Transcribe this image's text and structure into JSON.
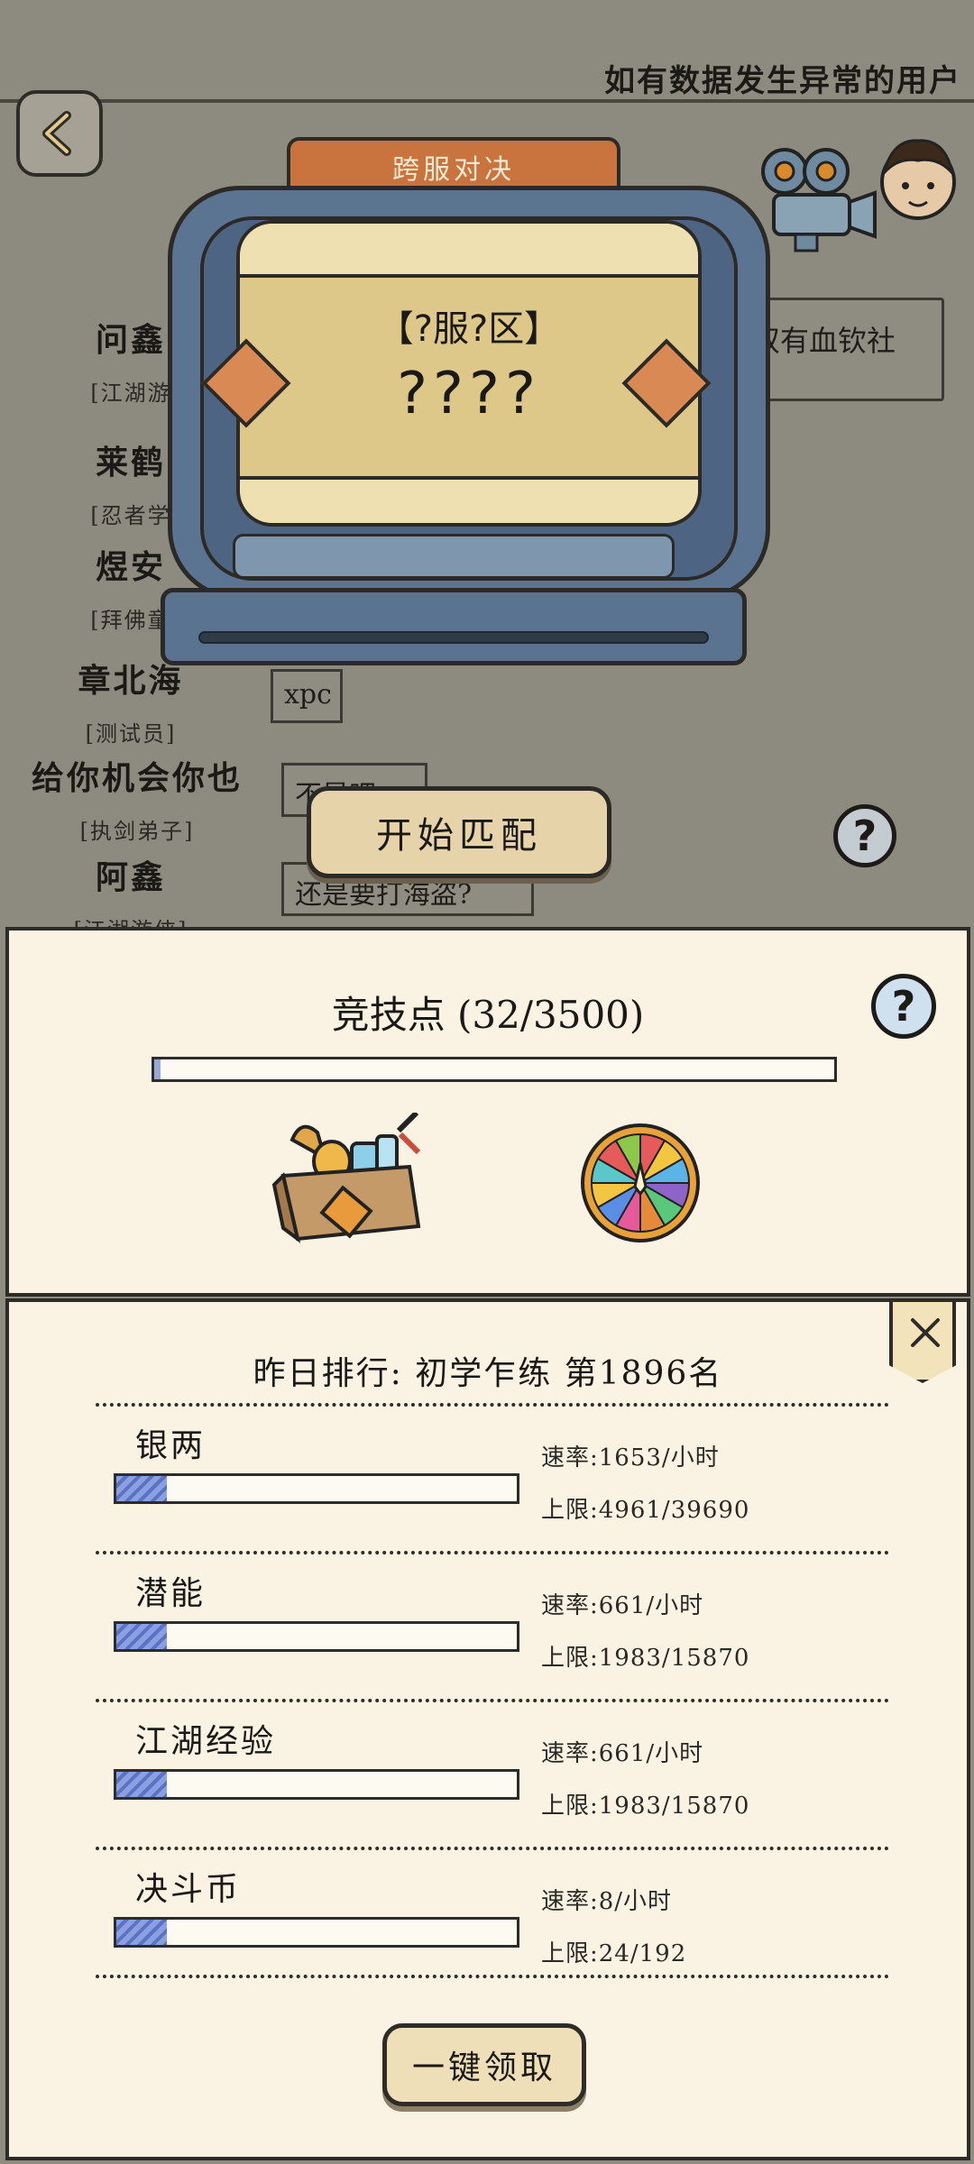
{
  "header": {
    "notice": "如有数据发生异常的用户"
  },
  "chat": {
    "snippet": "双有血钦社"
  },
  "players": [
    {
      "name": "问鑫",
      "title": "[江湖游"
    },
    {
      "name": "莱鹤",
      "title": "[忍者学"
    },
    {
      "name": "煜安",
      "title": "[拜佛童"
    },
    {
      "name": "章北海",
      "title": "[测试员]",
      "message": "xpc"
    },
    {
      "name": "给你机会你也",
      "title": "[执剑弟子]",
      "message": "不是吧"
    },
    {
      "name": "阿鑫",
      "title": "[江湖游侠]",
      "message": "还是要打海盗?"
    }
  ],
  "machine": {
    "tab": "跨服对决",
    "server": "【?服?区】",
    "opponent": "????"
  },
  "match": {
    "button": "开始匹配",
    "help": "?"
  },
  "arena": {
    "title": "竞技点 (32/3500)",
    "current": 32,
    "max": 3500,
    "help": "?"
  },
  "ranking": {
    "title": "昨日排行: 初学乍练  第1896名",
    "resources": [
      {
        "name": "银两",
        "rate": "速率:1653/小时",
        "cap": "上限:4961/39690",
        "fill": 0.125
      },
      {
        "name": "潜能",
        "rate": "速率:661/小时",
        "cap": "上限:1983/15870",
        "fill": 0.125
      },
      {
        "name": "江湖经验",
        "rate": "速率:661/小时",
        "cap": "上限:1983/15870",
        "fill": 0.125
      },
      {
        "name": "决斗币",
        "rate": "速率:8/小时",
        "cap": "上限:24/192",
        "fill": 0.125
      }
    ],
    "claim_button": "一键领取"
  },
  "icons": {
    "back": "back-arrow-icon",
    "camera": "movie-camera-icon",
    "avatar": "character-avatar-icon",
    "chest": "reward-chest-icon",
    "wheel": "lucky-wheel-icon",
    "close": "close-icon"
  }
}
